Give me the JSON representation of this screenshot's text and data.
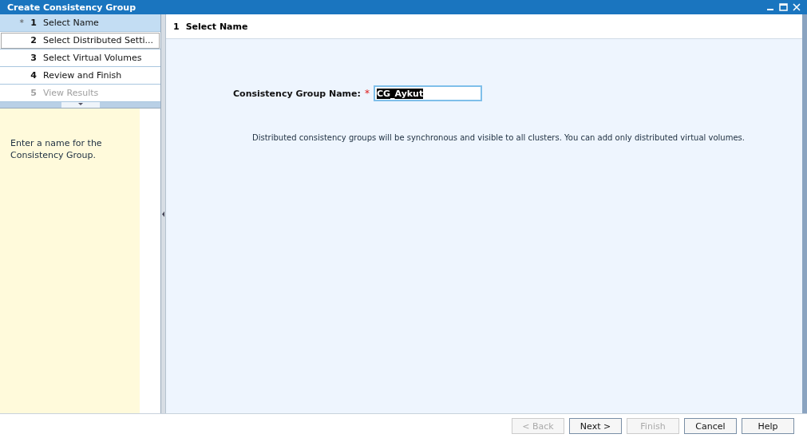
{
  "window": {
    "title": "Create Consistency Group"
  },
  "steps": [
    {
      "marker": "*",
      "number": "1",
      "label": "Select Name",
      "selected": true,
      "disabled": false,
      "focused": false
    },
    {
      "number": "2",
      "label": "Select Distributed Setti...",
      "selected": false,
      "disabled": false,
      "focused": true
    },
    {
      "number": "3",
      "label": "Select Virtual Volumes",
      "selected": false,
      "disabled": false,
      "focused": false
    },
    {
      "number": "4",
      "label": "Review and Finish",
      "selected": false,
      "disabled": false,
      "focused": false
    },
    {
      "number": "5",
      "label": "View Results",
      "selected": false,
      "disabled": true,
      "focused": false
    }
  ],
  "help_text": "Enter a name for the Consistency Group.",
  "page": {
    "number": "1",
    "title": "Select Name"
  },
  "name_field": {
    "label": "Consistency Group Name:",
    "required_mark": "*",
    "value": "CG_Aykut",
    "text_selected": true
  },
  "note": "Distributed consistency groups will be synchronous and visible to all clusters. You can add only distributed virtual volumes.",
  "buttons": [
    {
      "label": "< Back",
      "disabled": true
    },
    {
      "label": "Next >",
      "disabled": false
    },
    {
      "label": "Finish",
      "disabled": true
    },
    {
      "label": "Cancel",
      "disabled": false
    },
    {
      "label": "Help",
      "disabled": false
    }
  ]
}
